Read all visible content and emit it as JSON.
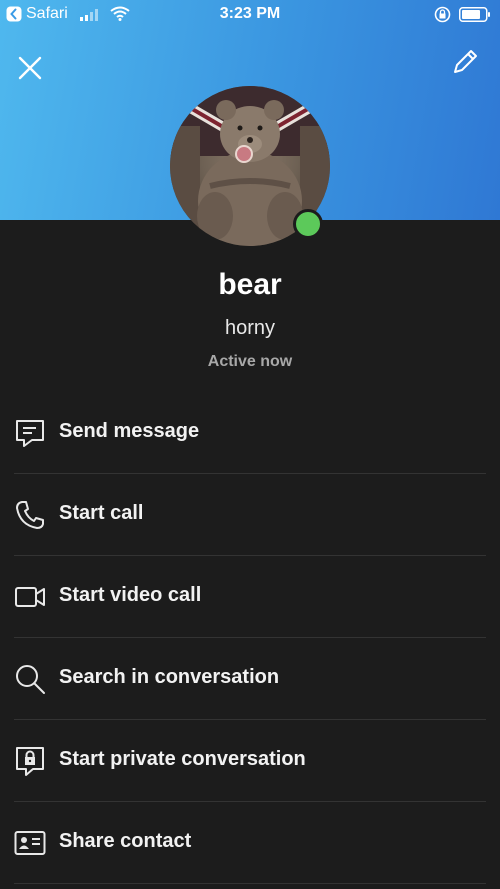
{
  "status_bar": {
    "back_app": "Safari",
    "time": "3:23 PM"
  },
  "header": {
    "close_icon": "close-icon",
    "edit_icon": "pencil-icon",
    "gradient_colors": [
      "#4fb8ee",
      "#2f78d4"
    ]
  },
  "profile": {
    "name": "bear",
    "mood": "horny",
    "presence": "Active now",
    "presence_color": "#5cc95a"
  },
  "actions": [
    {
      "label": "Send message",
      "icon": "message-icon"
    },
    {
      "label": "Start call",
      "icon": "phone-icon"
    },
    {
      "label": "Start video call",
      "icon": "video-camera-icon"
    },
    {
      "label": "Search in conversation",
      "icon": "search-icon"
    },
    {
      "label": "Start private conversation",
      "icon": "lock-icon"
    },
    {
      "label": "Share contact",
      "icon": "contact-card-icon"
    }
  ]
}
